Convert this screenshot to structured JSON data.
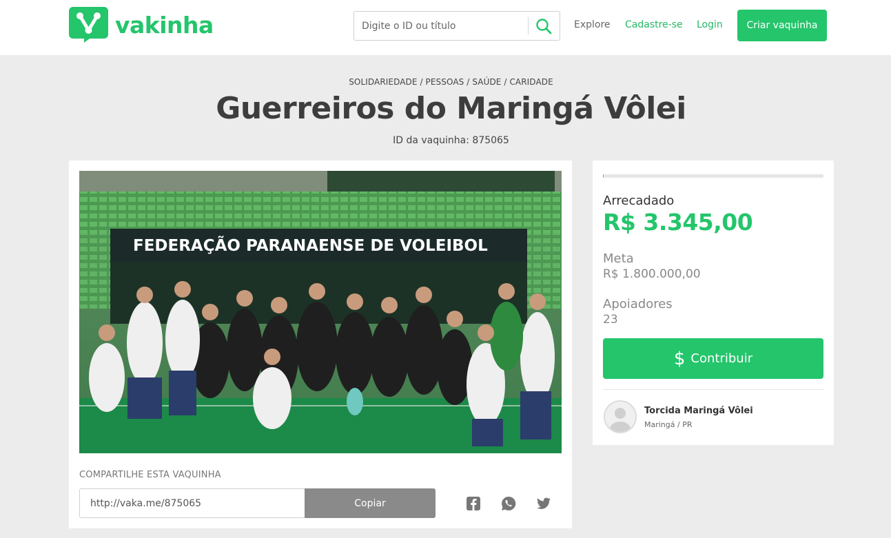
{
  "header": {
    "logo_text": "vakinha",
    "search_placeholder": "Digite o ID ou título",
    "nav": {
      "explore": "Explore",
      "signup": "Cadastre-se",
      "login": "Login"
    },
    "cta": "Criar vaquinha"
  },
  "campaign": {
    "breadcrumb": "SOLIDARIEDADE / PESSOAS / SAÚDE / CARIDADE",
    "title": "Guerreiros do Maringá Vôlei",
    "id_line": "ID da vaquinha: 875065",
    "photo_banner_text": "FEDERAÇÃO PARANAENSE DE VOLEIBOL"
  },
  "share": {
    "label": "COMPARTILHE ESTA VAQUINHA",
    "url": "http://vaka.me/875065",
    "copy": "Copiar"
  },
  "stats": {
    "progress_fraction": 0.002,
    "raised_label": "Arrecadado",
    "raised_value": "R$ 3.345,00",
    "goal_label": "Meta",
    "goal_value": "R$ 1.800.000,00",
    "supporters_label": "Apoiadores",
    "supporters_value": "23",
    "contribute": "Contribuir"
  },
  "owner": {
    "name": "Torcida Maringá Vôlei",
    "location": "Maringá / PR"
  },
  "colors": {
    "brand_green": "#24c56b",
    "copy_button_gray": "#8a8a8a",
    "page_background": "#ececec"
  },
  "icons": {
    "search": "magnifier-icon",
    "facebook": "facebook-icon",
    "whatsapp": "whatsapp-icon",
    "twitter": "twitter-icon",
    "dollar": "dollar-icon"
  }
}
